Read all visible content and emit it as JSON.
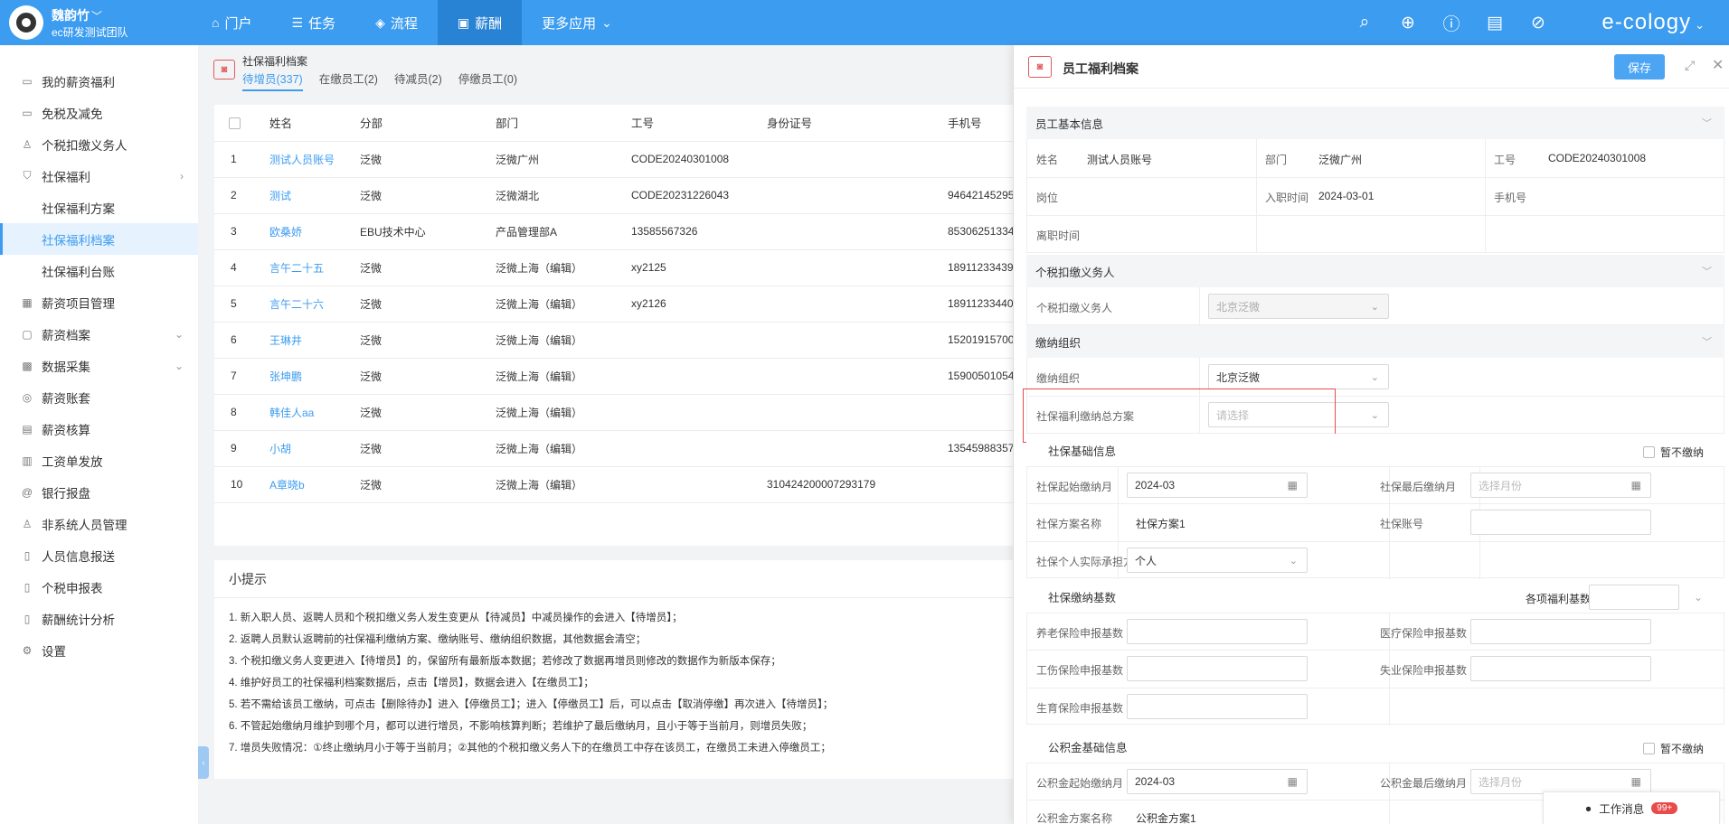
{
  "user": {
    "name": "魏韵竹",
    "team": "ec研发测试团队"
  },
  "nav": [
    {
      "label": "门户",
      "icon": "home-icon"
    },
    {
      "label": "任务",
      "icon": "list-icon"
    },
    {
      "label": "流程",
      "icon": "layers-icon"
    },
    {
      "label": "薪酬",
      "icon": "money-icon"
    },
    {
      "label": "更多应用",
      "icon": "chevron-down-icon"
    }
  ],
  "brand": "e-cology",
  "sidebar": [
    {
      "label": "我的薪资福利",
      "icon": "wallet-icon"
    },
    {
      "label": "免税及减免",
      "icon": "wallet-icon"
    },
    {
      "label": "个税扣缴义务人",
      "icon": "person-icon"
    },
    {
      "label": "社保福利",
      "icon": "shield-icon"
    },
    {
      "label": "社保福利方案"
    },
    {
      "label": "社保福利档案"
    },
    {
      "label": "社保福利台账"
    },
    {
      "label": "薪资项目管理",
      "icon": "grid-icon"
    },
    {
      "label": "薪资档案",
      "icon": "folder-icon"
    },
    {
      "label": "数据采集",
      "icon": "collect-icon"
    },
    {
      "label": "薪资账套",
      "icon": "book-icon"
    },
    {
      "label": "薪资核算",
      "icon": "calc-icon"
    },
    {
      "label": "工资单发放",
      "icon": "send-icon"
    },
    {
      "label": "银行报盘",
      "icon": "bank-icon"
    },
    {
      "label": "非系统人员管理",
      "icon": "person-icon"
    },
    {
      "label": "人员信息报送",
      "icon": "doc-icon"
    },
    {
      "label": "个税申报表",
      "icon": "doc-icon"
    },
    {
      "label": "薪酬统计分析",
      "icon": "chart-icon"
    },
    {
      "label": "设置",
      "icon": "gear-icon"
    }
  ],
  "page": {
    "title": "社保福利档案",
    "tabs": [
      "待增员(337)",
      "在缴员工(2)",
      "待减员(2)",
      "停缴员工(0)"
    ]
  },
  "table": {
    "columns": [
      "姓名",
      "分部",
      "部门",
      "工号",
      "身份证号",
      "手机号"
    ],
    "rows": [
      {
        "no": "1",
        "name": "测试人员账号",
        "sub": "泛微",
        "dept": "泛微广州",
        "code": "CODE20240301008",
        "id": "",
        "phone": ""
      },
      {
        "no": "2",
        "name": "测试",
        "sub": "泛微",
        "dept": "泛微湖北",
        "code": "CODE20231226043",
        "id": "",
        "phone": "94642145295"
      },
      {
        "no": "3",
        "name": "欧桑娇",
        "sub": "EBU技术中心",
        "dept": "产品管理部A",
        "code": "13585567326",
        "id": "",
        "phone": "85306251334"
      },
      {
        "no": "4",
        "name": "言午二十五",
        "sub": "泛微",
        "dept": "泛微上海（编辑）",
        "code": "xy2125",
        "id": "",
        "phone": "18911233439"
      },
      {
        "no": "5",
        "name": "言午二十六",
        "sub": "泛微",
        "dept": "泛微上海（编辑）",
        "code": "xy2126",
        "id": "",
        "phone": "18911233440"
      },
      {
        "no": "6",
        "name": "王琳井",
        "sub": "泛微",
        "dept": "泛微上海（编辑）",
        "code": "",
        "id": "",
        "phone": "15201915700"
      },
      {
        "no": "7",
        "name": "张坤鹏",
        "sub": "泛微",
        "dept": "泛微上海（编辑）",
        "code": "",
        "id": "",
        "phone": "15900501054"
      },
      {
        "no": "8",
        "name": "韩佳人aa",
        "sub": "泛微",
        "dept": "泛微上海（编辑）",
        "code": "",
        "id": "",
        "phone": ""
      },
      {
        "no": "9",
        "name": "小胡",
        "sub": "泛微",
        "dept": "泛微上海（编辑）",
        "code": "",
        "id": "",
        "phone": "13545988357"
      },
      {
        "no": "10",
        "name": "A章晓b",
        "sub": "泛微",
        "dept": "泛微上海（编辑）",
        "code": "",
        "id": "310424200007293179",
        "phone": ""
      }
    ]
  },
  "tips": {
    "title": "小提示",
    "items": [
      "1. 新入职人员、返聘人员和个税扣缴义务人发生变更从【待减员】中减员操作的会进入【待增员】；",
      "2. 返聘人员默认返聘前的社保福利缴纳方案、缴纳账号、缴纳组织数据，其他数据会清空；",
      "3. 个税扣缴义务人变更进入【待增员】的，保留所有最新版本数据；若修改了数据再增员则修改的数据作为新版本保存；",
      "4. 维护好员工的社保福利档案数据后，点击【增员】，数据会进入【在缴员工】；",
      "5. 若不需给该员工缴纳，可点击【删除待办】进入【停缴员工】；进入【停缴员工】后，可以点击【取消停缴】再次进入【待增员】；",
      "6. 不管起始缴纳月维护到哪个月，都可以进行增员，不影响核算判断；若维护了最后缴纳月，且小于等于当前月，则增员失败；",
      "7. 增员失败情况：①终止缴纳月小于等于当前月；②其他的个税扣缴义务人下的在缴员工中存在该员工，在缴员工未进入停缴员工；"
    ]
  },
  "panel": {
    "title": "员工福利档案",
    "save": "保存",
    "basic": {
      "title": "员工基本信息",
      "name_label": "姓名",
      "name": "测试人员账号",
      "dept_label": "部门",
      "dept": "泛微广州",
      "code_label": "工号",
      "code": "CODE20240301008",
      "post_label": "岗位",
      "join_label": "入职时间",
      "join": "2024-03-01",
      "phone_label": "手机号",
      "leave_label": "离职时间"
    },
    "tax": {
      "title": "个税扣缴义务人",
      "label": "个税扣缴义务人",
      "value": "北京泛微"
    },
    "org": {
      "title": "缴纳组织",
      "label": "缴纳组织",
      "value": "北京泛微",
      "plan_label": "社保福利缴纳总方案",
      "plan_placeholder": "请选择"
    },
    "si": {
      "title": "社保基础信息",
      "stop_label": "暂不缴纳",
      "start_label": "社保起始缴纳月",
      "start": "2024-03",
      "end_label": "社保最后缴纳月",
      "end_placeholder": "选择月份",
      "plan_label": "社保方案名称",
      "plan": "社保方案1",
      "acct_label": "社保账号",
      "bearer_label": "社保个人实际承担方",
      "bearer": "个人"
    },
    "base": {
      "title": "社保缴纳基数",
      "same_label": "各项福利基数一致:",
      "pension": "养老保险申报基数",
      "medical": "医疗保险申报基数",
      "injury": "工伤保险申报基数",
      "unemploy": "失业保险申报基数",
      "birth": "生育保险申报基数"
    },
    "fund": {
      "title": "公积金基础信息",
      "stop_label": "暂不缴纳",
      "start_label": "公积金起始缴纳月",
      "start": "2024-03",
      "end_label": "公积金最后缴纳月",
      "end_placeholder": "选择月份",
      "plan_label": "公积金方案名称",
      "plan": "公积金方案1"
    }
  },
  "messages": {
    "label": "工作消息",
    "badge": "99+"
  }
}
